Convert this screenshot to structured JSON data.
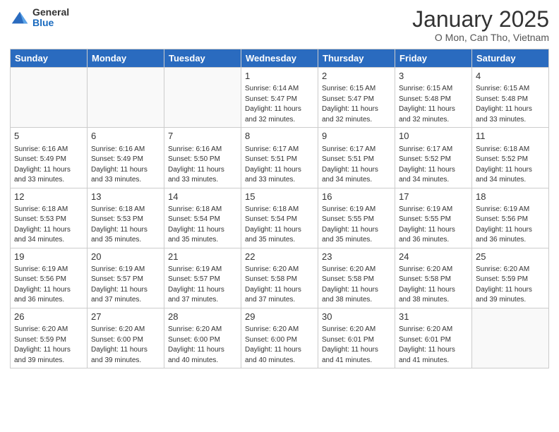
{
  "logo": {
    "general": "General",
    "blue": "Blue"
  },
  "header": {
    "month": "January 2025",
    "location": "O Mon, Can Tho, Vietnam"
  },
  "weekdays": [
    "Sunday",
    "Monday",
    "Tuesday",
    "Wednesday",
    "Thursday",
    "Friday",
    "Saturday"
  ],
  "weeks": [
    [
      {
        "day": "",
        "sunrise": "",
        "sunset": "",
        "daylight": "",
        "empty": true
      },
      {
        "day": "",
        "sunrise": "",
        "sunset": "",
        "daylight": "",
        "empty": true
      },
      {
        "day": "",
        "sunrise": "",
        "sunset": "",
        "daylight": "",
        "empty": true
      },
      {
        "day": "1",
        "sunrise": "Sunrise: 6:14 AM",
        "sunset": "Sunset: 5:47 PM",
        "daylight": "Daylight: 11 hours and 32 minutes.",
        "empty": false
      },
      {
        "day": "2",
        "sunrise": "Sunrise: 6:15 AM",
        "sunset": "Sunset: 5:47 PM",
        "daylight": "Daylight: 11 hours and 32 minutes.",
        "empty": false
      },
      {
        "day": "3",
        "sunrise": "Sunrise: 6:15 AM",
        "sunset": "Sunset: 5:48 PM",
        "daylight": "Daylight: 11 hours and 32 minutes.",
        "empty": false
      },
      {
        "day": "4",
        "sunrise": "Sunrise: 6:15 AM",
        "sunset": "Sunset: 5:48 PM",
        "daylight": "Daylight: 11 hours and 33 minutes.",
        "empty": false
      }
    ],
    [
      {
        "day": "5",
        "sunrise": "Sunrise: 6:16 AM",
        "sunset": "Sunset: 5:49 PM",
        "daylight": "Daylight: 11 hours and 33 minutes.",
        "empty": false
      },
      {
        "day": "6",
        "sunrise": "Sunrise: 6:16 AM",
        "sunset": "Sunset: 5:49 PM",
        "daylight": "Daylight: 11 hours and 33 minutes.",
        "empty": false
      },
      {
        "day": "7",
        "sunrise": "Sunrise: 6:16 AM",
        "sunset": "Sunset: 5:50 PM",
        "daylight": "Daylight: 11 hours and 33 minutes.",
        "empty": false
      },
      {
        "day": "8",
        "sunrise": "Sunrise: 6:17 AM",
        "sunset": "Sunset: 5:51 PM",
        "daylight": "Daylight: 11 hours and 33 minutes.",
        "empty": false
      },
      {
        "day": "9",
        "sunrise": "Sunrise: 6:17 AM",
        "sunset": "Sunset: 5:51 PM",
        "daylight": "Daylight: 11 hours and 34 minutes.",
        "empty": false
      },
      {
        "day": "10",
        "sunrise": "Sunrise: 6:17 AM",
        "sunset": "Sunset: 5:52 PM",
        "daylight": "Daylight: 11 hours and 34 minutes.",
        "empty": false
      },
      {
        "day": "11",
        "sunrise": "Sunrise: 6:18 AM",
        "sunset": "Sunset: 5:52 PM",
        "daylight": "Daylight: 11 hours and 34 minutes.",
        "empty": false
      }
    ],
    [
      {
        "day": "12",
        "sunrise": "Sunrise: 6:18 AM",
        "sunset": "Sunset: 5:53 PM",
        "daylight": "Daylight: 11 hours and 34 minutes.",
        "empty": false
      },
      {
        "day": "13",
        "sunrise": "Sunrise: 6:18 AM",
        "sunset": "Sunset: 5:53 PM",
        "daylight": "Daylight: 11 hours and 35 minutes.",
        "empty": false
      },
      {
        "day": "14",
        "sunrise": "Sunrise: 6:18 AM",
        "sunset": "Sunset: 5:54 PM",
        "daylight": "Daylight: 11 hours and 35 minutes.",
        "empty": false
      },
      {
        "day": "15",
        "sunrise": "Sunrise: 6:18 AM",
        "sunset": "Sunset: 5:54 PM",
        "daylight": "Daylight: 11 hours and 35 minutes.",
        "empty": false
      },
      {
        "day": "16",
        "sunrise": "Sunrise: 6:19 AM",
        "sunset": "Sunset: 5:55 PM",
        "daylight": "Daylight: 11 hours and 35 minutes.",
        "empty": false
      },
      {
        "day": "17",
        "sunrise": "Sunrise: 6:19 AM",
        "sunset": "Sunset: 5:55 PM",
        "daylight": "Daylight: 11 hours and 36 minutes.",
        "empty": false
      },
      {
        "day": "18",
        "sunrise": "Sunrise: 6:19 AM",
        "sunset": "Sunset: 5:56 PM",
        "daylight": "Daylight: 11 hours and 36 minutes.",
        "empty": false
      }
    ],
    [
      {
        "day": "19",
        "sunrise": "Sunrise: 6:19 AM",
        "sunset": "Sunset: 5:56 PM",
        "daylight": "Daylight: 11 hours and 36 minutes.",
        "empty": false
      },
      {
        "day": "20",
        "sunrise": "Sunrise: 6:19 AM",
        "sunset": "Sunset: 5:57 PM",
        "daylight": "Daylight: 11 hours and 37 minutes.",
        "empty": false
      },
      {
        "day": "21",
        "sunrise": "Sunrise: 6:19 AM",
        "sunset": "Sunset: 5:57 PM",
        "daylight": "Daylight: 11 hours and 37 minutes.",
        "empty": false
      },
      {
        "day": "22",
        "sunrise": "Sunrise: 6:20 AM",
        "sunset": "Sunset: 5:58 PM",
        "daylight": "Daylight: 11 hours and 37 minutes.",
        "empty": false
      },
      {
        "day": "23",
        "sunrise": "Sunrise: 6:20 AM",
        "sunset": "Sunset: 5:58 PM",
        "daylight": "Daylight: 11 hours and 38 minutes.",
        "empty": false
      },
      {
        "day": "24",
        "sunrise": "Sunrise: 6:20 AM",
        "sunset": "Sunset: 5:58 PM",
        "daylight": "Daylight: 11 hours and 38 minutes.",
        "empty": false
      },
      {
        "day": "25",
        "sunrise": "Sunrise: 6:20 AM",
        "sunset": "Sunset: 5:59 PM",
        "daylight": "Daylight: 11 hours and 39 minutes.",
        "empty": false
      }
    ],
    [
      {
        "day": "26",
        "sunrise": "Sunrise: 6:20 AM",
        "sunset": "Sunset: 5:59 PM",
        "daylight": "Daylight: 11 hours and 39 minutes.",
        "empty": false
      },
      {
        "day": "27",
        "sunrise": "Sunrise: 6:20 AM",
        "sunset": "Sunset: 6:00 PM",
        "daylight": "Daylight: 11 hours and 39 minutes.",
        "empty": false
      },
      {
        "day": "28",
        "sunrise": "Sunrise: 6:20 AM",
        "sunset": "Sunset: 6:00 PM",
        "daylight": "Daylight: 11 hours and 40 minutes.",
        "empty": false
      },
      {
        "day": "29",
        "sunrise": "Sunrise: 6:20 AM",
        "sunset": "Sunset: 6:00 PM",
        "daylight": "Daylight: 11 hours and 40 minutes.",
        "empty": false
      },
      {
        "day": "30",
        "sunrise": "Sunrise: 6:20 AM",
        "sunset": "Sunset: 6:01 PM",
        "daylight": "Daylight: 11 hours and 41 minutes.",
        "empty": false
      },
      {
        "day": "31",
        "sunrise": "Sunrise: 6:20 AM",
        "sunset": "Sunset: 6:01 PM",
        "daylight": "Daylight: 11 hours and 41 minutes.",
        "empty": false
      },
      {
        "day": "",
        "sunrise": "",
        "sunset": "",
        "daylight": "",
        "empty": true
      }
    ]
  ]
}
